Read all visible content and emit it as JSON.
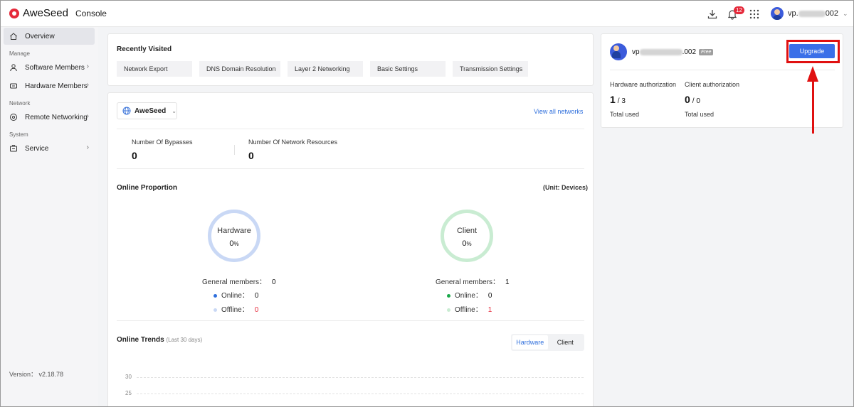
{
  "header": {
    "brand": "AweSeed",
    "console_label": "Console",
    "notification_count": "12",
    "user_prefix": "vp.",
    "user_suffix": "002"
  },
  "sidebar": {
    "overview": "Overview",
    "section_manage": "Manage",
    "software_members": "Software Members",
    "hardware_members": "Hardware Members",
    "section_network": "Network",
    "remote_networking": "Remote Networking",
    "section_system": "System",
    "service": "Service",
    "version": "Version： v2.18.78"
  },
  "recently_visited": {
    "title": "Recently Visited",
    "tags": [
      "Network Export",
      "DNS Domain Resolution",
      "Layer 2 Networking",
      "Basic Settings",
      "Transmission Settings"
    ]
  },
  "network": {
    "selected": "AweSeed",
    "view_all": "View all networks",
    "bypasses_label": "Number Of Bypasses",
    "bypasses_value": "0",
    "resources_label": "Number Of Network Resources",
    "resources_value": "0"
  },
  "online_proportion": {
    "title": "Online Proportion",
    "unit": "(Unit: Devices)",
    "hardware": {
      "label": "Hardware",
      "percent": "0",
      "percent_unit": "%",
      "general_label": "General members：",
      "general_value": "0",
      "online_label": "Online：",
      "online_value": "0",
      "offline_label": "Offline：",
      "offline_value": "0"
    },
    "client": {
      "label": "Client",
      "percent": "0",
      "percent_unit": "%",
      "general_label": "General members：",
      "general_value": "1",
      "online_label": "Online：",
      "online_value": "0",
      "offline_label": "Offline：",
      "offline_value": "1"
    }
  },
  "online_trends": {
    "title": "Online Trends",
    "subtitle": "(Last 30 days)",
    "tabs": [
      "Hardware",
      "Client"
    ],
    "y_ticks": [
      "30",
      "25"
    ]
  },
  "account": {
    "name_prefix": "vp",
    "name_suffix": ".002",
    "plan": "Free",
    "upgrade_label": "Upgrade",
    "hardware_auth_label": "Hardware authorization",
    "hardware_used": "1",
    "hardware_total": "/ 3",
    "hardware_caption": "Total used",
    "client_auth_label": "Client authorization",
    "client_used": "0",
    "client_total": "/ 0",
    "client_caption": "Total used"
  },
  "colors": {
    "accent": "#3a6fe8",
    "brand_red": "#e5293a",
    "hardware_ring": "#c9d8f5",
    "client_ring": "#c9ecd2",
    "annotation_red": "#e01010"
  }
}
